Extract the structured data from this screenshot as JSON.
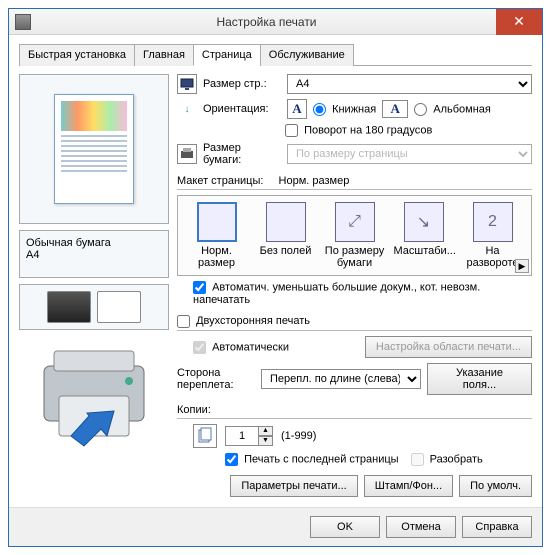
{
  "window": {
    "title": "Настройка печати"
  },
  "tabs": [
    "Быстрая установка",
    "Главная",
    "Страница",
    "Обслуживание"
  ],
  "active_tab": 2,
  "left": {
    "paper_type": "Обычная бумага",
    "paper_size": "A4"
  },
  "page_size": {
    "label": "Размер стр.:",
    "value": "A4"
  },
  "orientation": {
    "label": "Ориентация:",
    "portrait": "Книжная",
    "landscape": "Альбомная",
    "selected": "portrait",
    "rotate180": "Поворот на 180 градусов",
    "rotate180_checked": false
  },
  "printer_size": {
    "label1": "Размер",
    "label2": "бумаги:",
    "value": "По размеру страницы"
  },
  "layout": {
    "header": "Макет страницы:",
    "current": "Норм. размер",
    "items": [
      {
        "label": "Норм. размер",
        "glyph": ""
      },
      {
        "label": "Без полей",
        "glyph": ""
      },
      {
        "label": "По размеру бумаги",
        "glyph": "⤢"
      },
      {
        "label": "Масштаби...",
        "glyph": "↘"
      },
      {
        "label": "На развороте",
        "glyph": "2"
      }
    ],
    "selected": 0
  },
  "autoreduce": {
    "label": "Автоматич. уменьшать большие докум., кот. невозм. напечатать",
    "checked": true
  },
  "duplex": {
    "label": "Двухсторонняя печать",
    "checked": false,
    "auto_label": "Автоматически",
    "auto_checked": true,
    "area_btn": "Настройка области печати...",
    "side_label1": "Сторона",
    "side_label2": "переплета:",
    "side_value": "Перепл. по длине (слева)",
    "margin_btn": "Указание поля..."
  },
  "copies": {
    "label": "Копии:",
    "value": "1",
    "range": "(1-999)",
    "reverse_label": "Печать с последней страницы",
    "reverse_checked": true,
    "collate_label": "Разобрать",
    "collate_checked": false
  },
  "bottom": {
    "print_options": "Параметры печати...",
    "stamp": "Штамп/Фон...",
    "defaults": "По умолч."
  },
  "dialog": {
    "ok": "OK",
    "cancel": "Отмена",
    "help": "Справка"
  }
}
